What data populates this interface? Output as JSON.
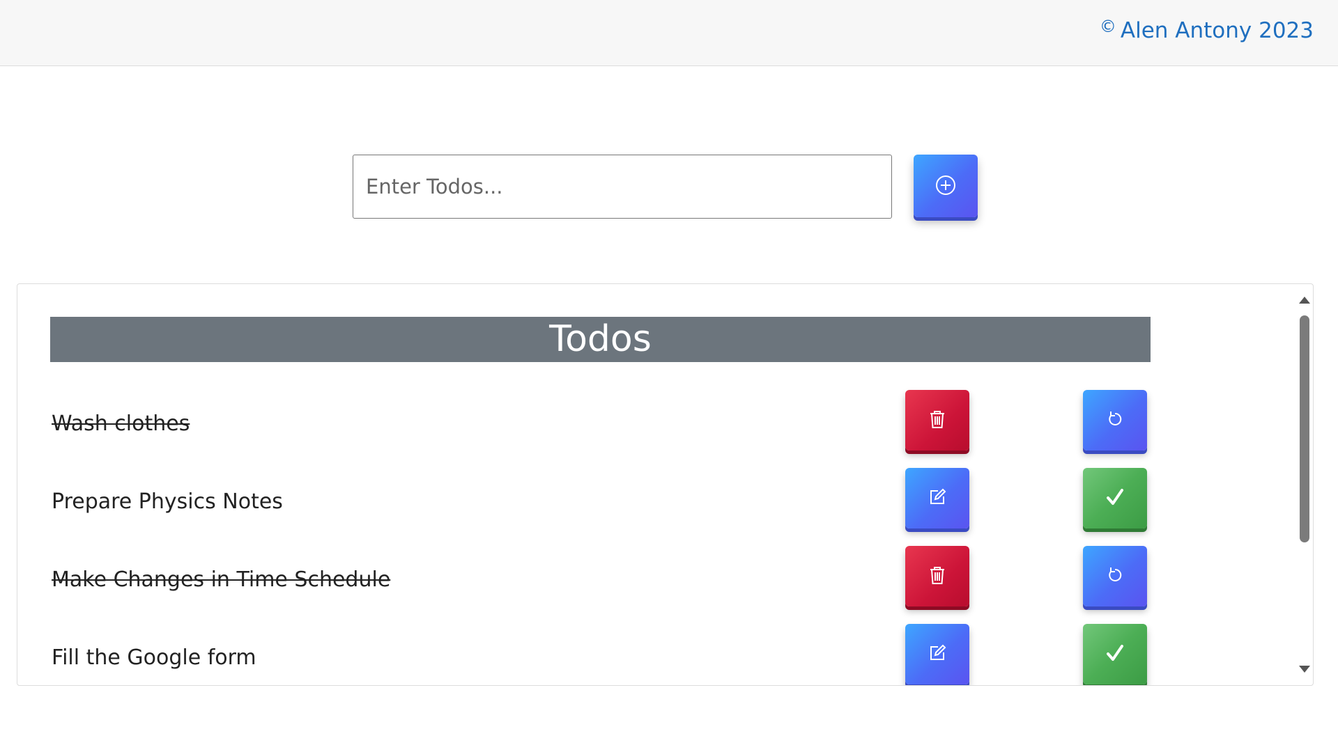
{
  "header": {
    "copyright_symbol": "©",
    "copyright_text": "Alen Antony 2023"
  },
  "input": {
    "placeholder": "Enter Todos...",
    "value": ""
  },
  "add_button": {
    "icon": "plus-circle-icon"
  },
  "list": {
    "title": "Todos",
    "items": [
      {
        "text": "Wash clothes",
        "completed": true,
        "actions": [
          "delete-icon",
          "undo-icon"
        ]
      },
      {
        "text": "Prepare Physics Notes",
        "completed": false,
        "actions": [
          "edit-icon",
          "check-icon"
        ]
      },
      {
        "text": "Make Changes in Time Schedule",
        "completed": true,
        "actions": [
          "delete-icon",
          "undo-icon"
        ]
      },
      {
        "text": "Fill the Google form",
        "completed": false,
        "actions": [
          "edit-icon",
          "check-icon"
        ]
      }
    ]
  },
  "colors": {
    "brand_blue": "#1f6fbf",
    "title_bar": "#6c757d",
    "delete_red": "#cc1438",
    "action_blue": "#4c6cf7",
    "complete_green": "#4cae55"
  }
}
